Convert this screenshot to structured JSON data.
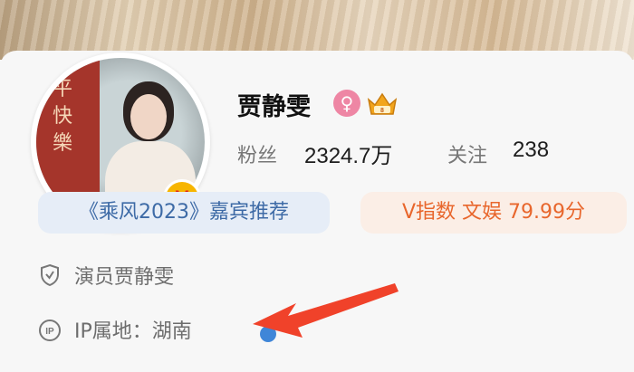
{
  "profile": {
    "name": "贾静雯",
    "avatar_poster_text": "平快樂",
    "verified_badge": "V",
    "gender_icon": "female-icon",
    "followers_label": "粉丝",
    "followers_value": "2324.7万",
    "following_label": "关注",
    "following_value": "238"
  },
  "tags": {
    "recommend": "《乘风2023》嘉宾推荐",
    "v_index": "V指数 文娱 79.99分"
  },
  "info": {
    "verification": "演员贾静雯",
    "ip_location": "IP属地：湖南"
  },
  "colors": {
    "accent_blue": "#3d6aa6",
    "accent_orange": "#e8662c",
    "arrow_red": "#f0422a",
    "female_pink": "#ee86a4",
    "badge_gold": "#f7b500"
  }
}
